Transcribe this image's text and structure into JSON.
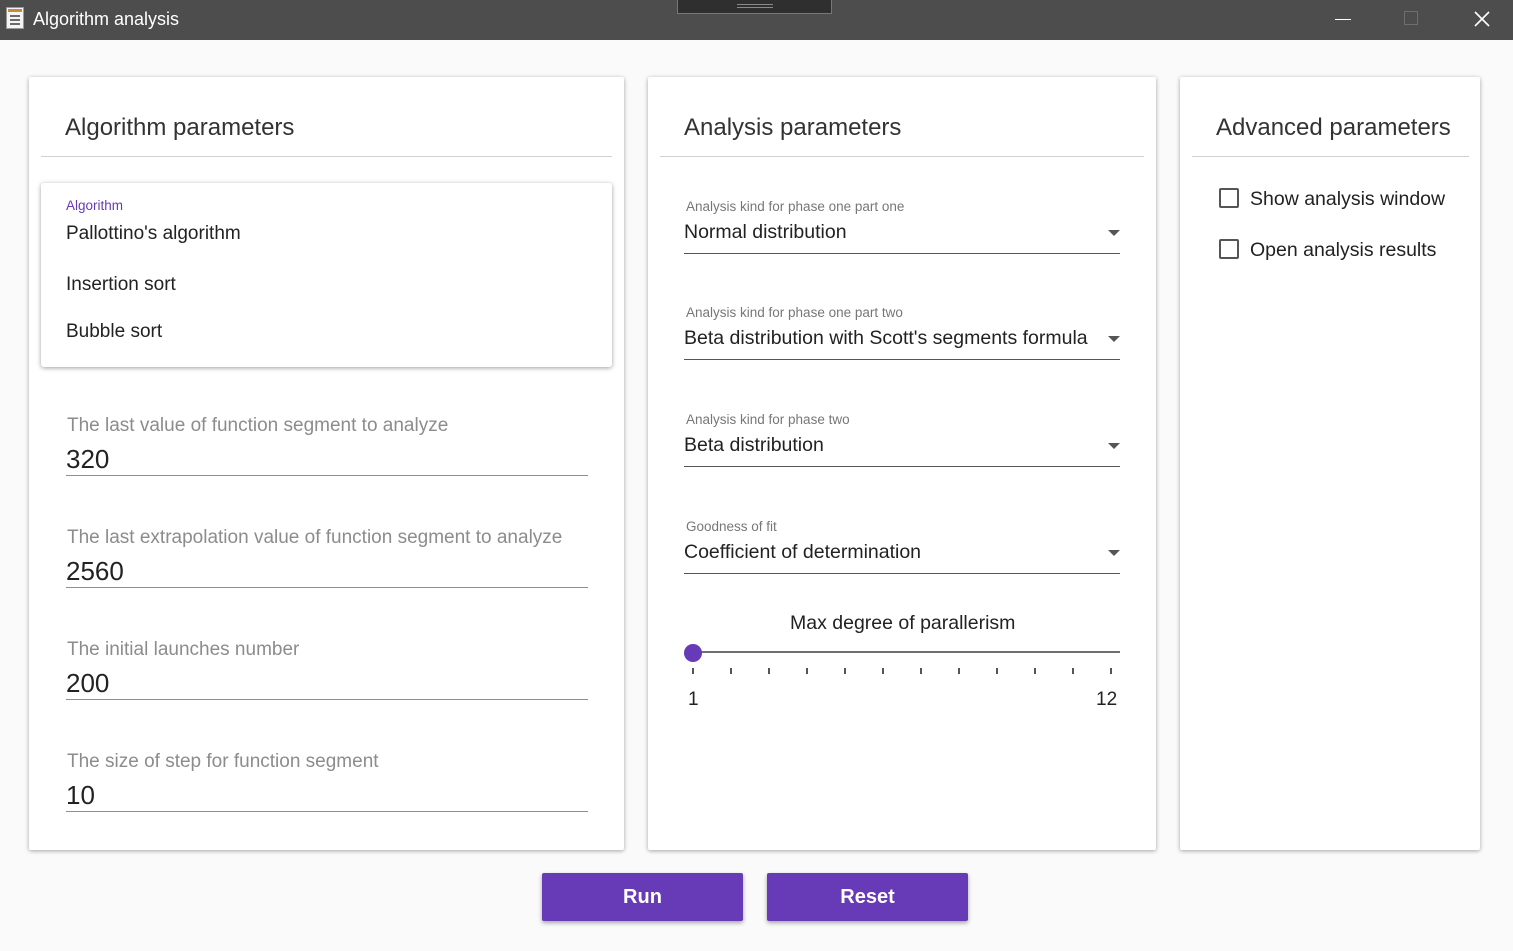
{
  "window": {
    "title": "Algorithm analysis",
    "icons": {
      "app": "app-document-icon",
      "minimize": "minimize-icon",
      "maximize": "maximize-icon",
      "close": "close-icon"
    }
  },
  "algorithm_panel": {
    "title": "Algorithm parameters",
    "algorithm_label": "Algorithm",
    "algorithms": [
      {
        "label": "Pallottino's algorithm"
      },
      {
        "label": "Insertion sort"
      },
      {
        "label": "Bubble sort"
      }
    ],
    "fields": [
      {
        "label": "The last value of function segment to analyze",
        "value": "320"
      },
      {
        "label": "The last extrapolation value of function segment to analyze",
        "value": "2560"
      },
      {
        "label": "The initial launches number",
        "value": "200"
      },
      {
        "label": "The size of step for function segment",
        "value": "10"
      }
    ]
  },
  "analysis_panel": {
    "title": "Analysis parameters",
    "selects": [
      {
        "label": "Analysis kind for phase one part one",
        "value": "Normal distribution"
      },
      {
        "label": "Analysis kind for phase one part two",
        "value": "Beta distribution with Scott's segments formula"
      },
      {
        "label": "Analysis kind for phase two",
        "value": "Beta distribution"
      },
      {
        "label": "Goodness of fit",
        "value": "Coefficient of determination"
      }
    ],
    "parallelism": {
      "label": "Max degree of parallerism",
      "min": 1,
      "max": 12,
      "value": 1,
      "min_label": "1",
      "max_label": "12"
    }
  },
  "advanced_panel": {
    "title": "Advanced parameters",
    "options": [
      {
        "label": "Show analysis window",
        "checked": false
      },
      {
        "label": "Open analysis results",
        "checked": false
      }
    ]
  },
  "actions": {
    "run_label": "Run",
    "reset_label": "Reset"
  },
  "colors": {
    "accent": "#673ab7",
    "titlebar": "#4d4d4d",
    "background": "#fafafa"
  }
}
